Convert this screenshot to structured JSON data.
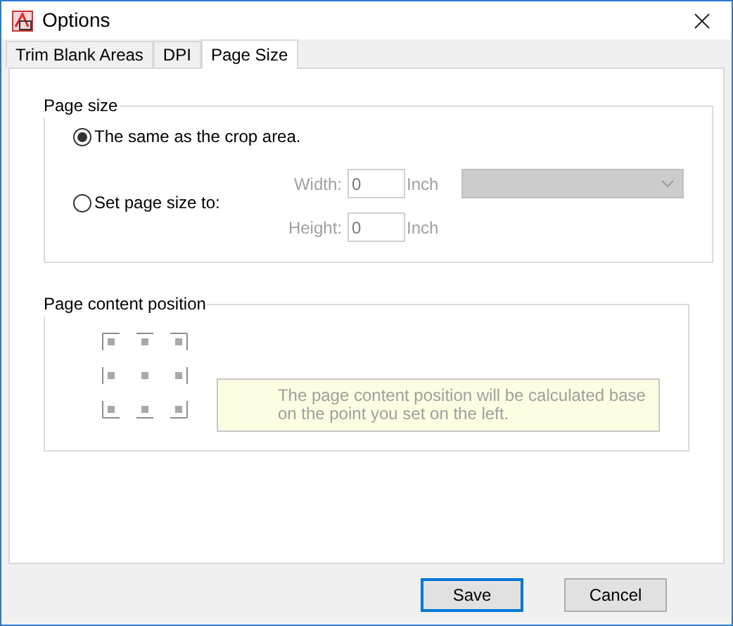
{
  "window": {
    "title": "Options"
  },
  "tabs": [
    {
      "label": "Trim Blank Areas",
      "selected": false
    },
    {
      "label": "DPI",
      "selected": false
    },
    {
      "label": "Page Size",
      "selected": true
    }
  ],
  "page_size": {
    "title": "Page size",
    "options": [
      {
        "label": "The same as the crop area.",
        "selected": true
      },
      {
        "label": "Set page size to:",
        "selected": false
      }
    ],
    "disabled": true,
    "fields": [
      {
        "label": "Width:",
        "value": "0",
        "unit": "Inch"
      },
      {
        "label": "Height:",
        "value": "0",
        "unit": "Inch"
      }
    ]
  },
  "position": {
    "title": "Page content position",
    "hint": "The page content position will be calculated base on the point you set on the left."
  },
  "buttons": [
    {
      "label": "Save",
      "default": true
    },
    {
      "label": "Cancel",
      "default": false
    }
  ]
}
